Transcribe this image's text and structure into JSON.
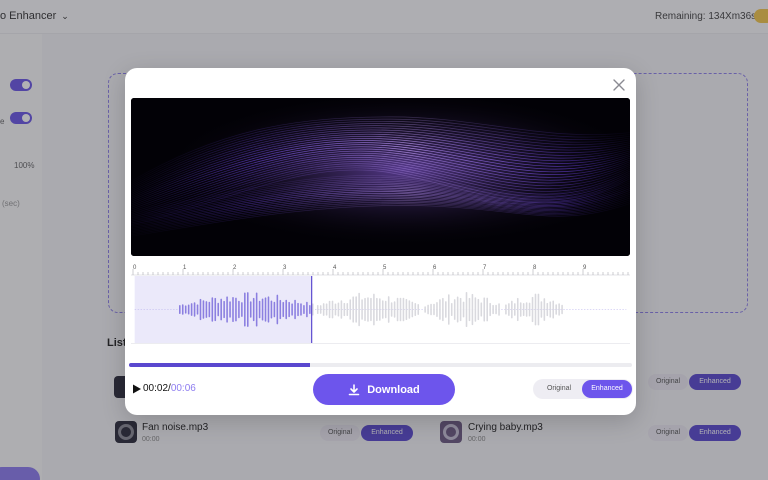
{
  "header": {
    "title": "o Enhancer",
    "remaining": "Remaining: 134Xm36s"
  },
  "sidebar": {
    "percent": "100%",
    "seconds": "(sec)"
  },
  "list": {
    "title": "List",
    "files": [
      {
        "name": "Fan noise.mp3",
        "duration": "00:00",
        "original_label": "Original",
        "enhanced_label": "Enhanced"
      },
      {
        "name": "Crying baby.mp3",
        "duration": "00:00",
        "original_label": "Original",
        "enhanced_label": "Enhanced"
      }
    ],
    "row1_original_label": "Original",
    "row1_enhanced_label": "Enhanced"
  },
  "modal": {
    "ruler_labels": [
      "0",
      "1",
      "2",
      "3",
      "4",
      "5",
      "6",
      "7",
      "8",
      "9"
    ],
    "playhead_fraction": 0.36,
    "current_time": "00:02",
    "total_time": "00:06",
    "time_separator": "/",
    "download_label": "Download",
    "original_label": "Original",
    "enhanced_label": "Enhanced",
    "icons": {
      "close": "close-icon",
      "play": "play-icon",
      "download": "download-icon"
    }
  },
  "colors": {
    "accent": "#6d55ec",
    "accent_dark": "#5a48cf",
    "wave_played": "#8b7fe0",
    "wave_unplayed": "#d9d9de"
  }
}
